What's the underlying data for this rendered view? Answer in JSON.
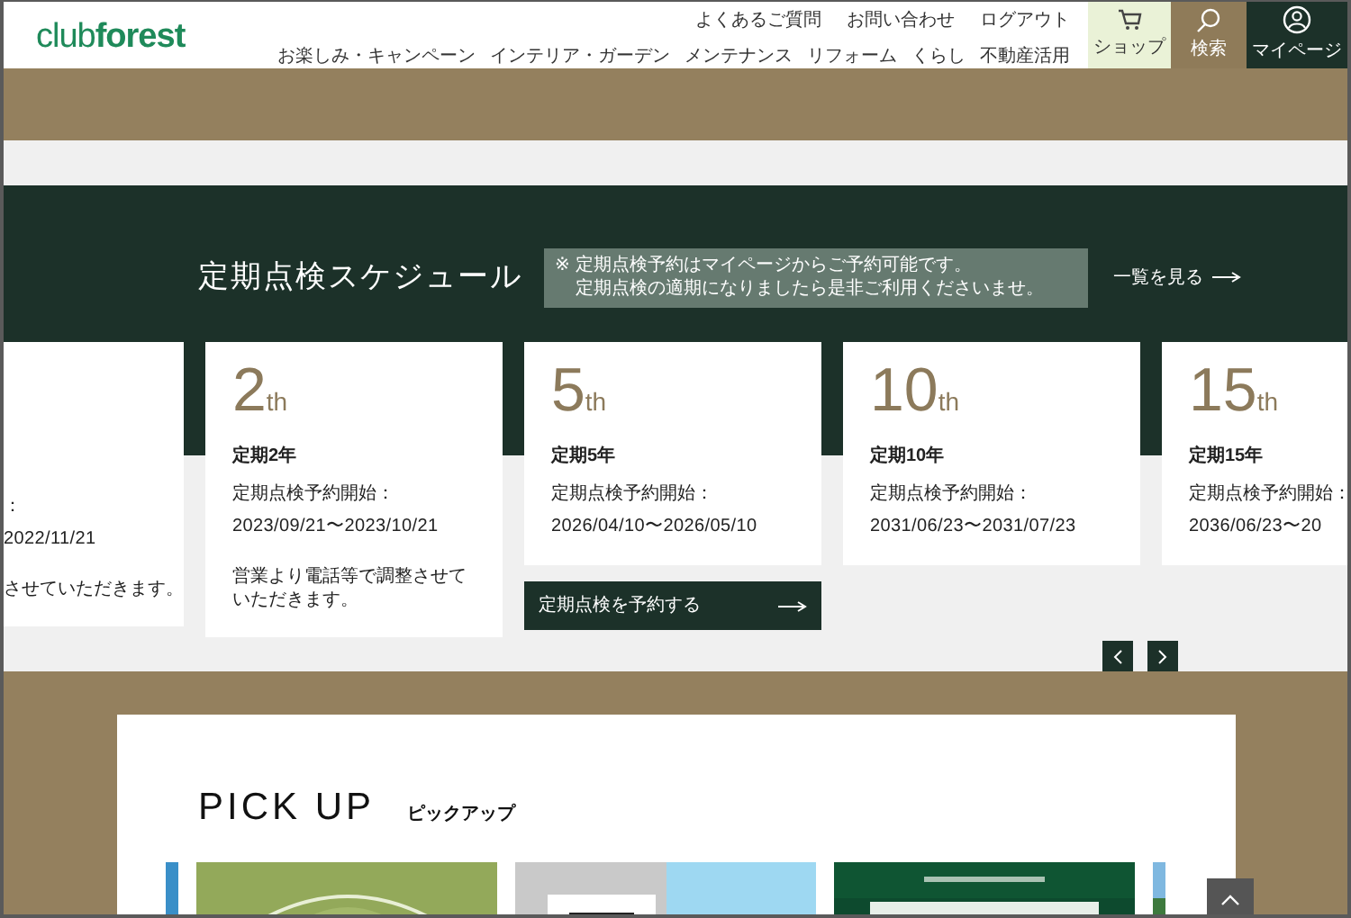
{
  "header": {
    "logo_left": "club",
    "logo_right": "forest",
    "top_links": [
      "よくあるご質問",
      "お問い合わせ",
      "ログアウト"
    ],
    "nav": [
      "お楽しみ・キャンペーン",
      "インテリア・ガーデン",
      "メンテナンス",
      "リフォーム",
      "くらし",
      "不動産活用"
    ],
    "actions": [
      {
        "kind": "shop",
        "label": "ショップ"
      },
      {
        "kind": "search",
        "label": "検索"
      },
      {
        "kind": "mypage",
        "label": "マイページ"
      }
    ]
  },
  "schedule": {
    "title": "定期点検スケジュール",
    "notice_mark": "※",
    "notice_lines": [
      "定期点検予約はマイページからご予約可能です。",
      "定期点検の適期になりましたら是非ご利用くださいませ。"
    ],
    "more_link": "一覧を見る",
    "cards": [
      {
        "kind": "partial",
        "label": "：",
        "dates": "2022/11/21",
        "note": "させていただきます。"
      },
      {
        "kind": "full",
        "number": "2",
        "suffix": "th",
        "title": "定期2年",
        "label": "定期点検予約開始：",
        "dates": "2023/09/21〜2023/10/21",
        "note": "営業より電話等で調整させていただきます。"
      },
      {
        "kind": "full",
        "number": "5",
        "suffix": "th",
        "title": "定期5年",
        "label": "定期点検予約開始：",
        "dates": "2026/04/10〜2026/05/10",
        "button": "定期点検を予約する"
      },
      {
        "kind": "full",
        "number": "10",
        "suffix": "th",
        "title": "定期10年",
        "label": "定期点検予約開始：",
        "dates": "2031/06/23〜2031/07/23"
      },
      {
        "kind": "full",
        "number": "15",
        "suffix": "th",
        "title": "定期15年",
        "label": "定期点検予約開始：",
        "dates": "2036/06/23〜20"
      }
    ]
  },
  "pickup": {
    "title": "PICK UP",
    "subtitle": "ピックアップ"
  }
}
